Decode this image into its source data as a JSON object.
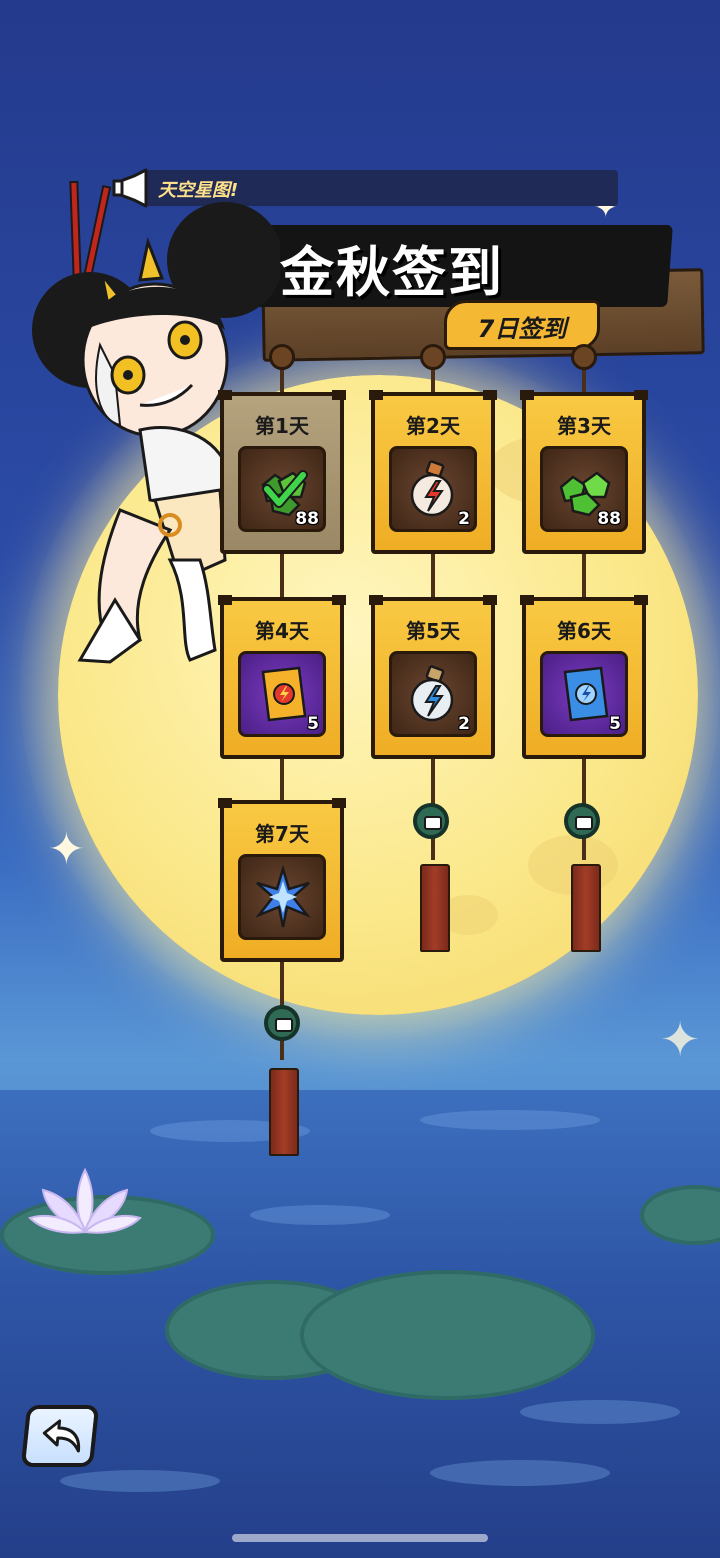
{
  "banner": {
    "ticker_text": "天空星图!",
    "title": "金秋签到",
    "subtitle": "7日签到"
  },
  "days": [
    {
      "label": "第1天",
      "qty": "88",
      "icon": "green-gem-claimed-icon",
      "claimed": true
    },
    {
      "label": "第2天",
      "qty": "2",
      "icon": "red-potion-icon",
      "claimed": false
    },
    {
      "label": "第3天",
      "qty": "88",
      "icon": "green-gem-icon",
      "claimed": false
    },
    {
      "label": "第4天",
      "qty": "5",
      "icon": "gold-card-pack-icon",
      "claimed": false
    },
    {
      "label": "第5天",
      "qty": "2",
      "icon": "blue-potion-icon",
      "claimed": false
    },
    {
      "label": "第6天",
      "qty": "5",
      "icon": "blue-card-pack-icon",
      "claimed": false
    },
    {
      "label": "第7天",
      "qty": "",
      "icon": "blue-crystal-icon",
      "claimed": false
    }
  ],
  "colors": {
    "card_gold": "#f9c943",
    "card_claimed": "#b5a37e",
    "sky": "#2b4ba6",
    "moon": "#fbe88a"
  }
}
